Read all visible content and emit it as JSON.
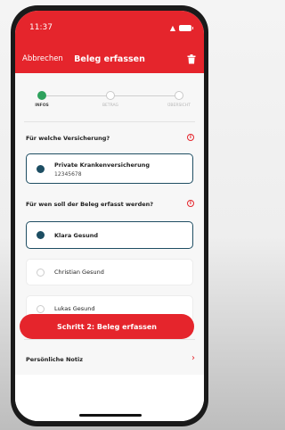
{
  "status_bar": {
    "time": "11:37"
  },
  "header": {
    "cancel_label": "Abbrechen",
    "title": "Beleg erfassen",
    "accent_color": "#e5252c"
  },
  "steps": [
    {
      "label": "INFOS",
      "active": true
    },
    {
      "label": "BETRAG",
      "active": false
    },
    {
      "label": "ÜBERSICHT",
      "active": false
    }
  ],
  "insurance": {
    "question": "Für welche Versicherung?",
    "selected": {
      "name": "Private Krankenversicherung",
      "number": "12345678"
    }
  },
  "persons": {
    "question": "Für wen soll der Beleg erfasst werden?",
    "options": [
      {
        "label": "Klara Gesund",
        "selected": true
      },
      {
        "label": "Christian Gesund",
        "selected": false
      },
      {
        "label": "Lukas Gesund",
        "selected": false
      }
    ]
  },
  "note": {
    "label": "Persönliche Notiz"
  },
  "cta": {
    "label": "Schritt 2: Beleg erfassen"
  },
  "icons": [
    "wifi-icon",
    "battery-icon",
    "trash-icon",
    "info-icon",
    "chevron-right-icon"
  ]
}
